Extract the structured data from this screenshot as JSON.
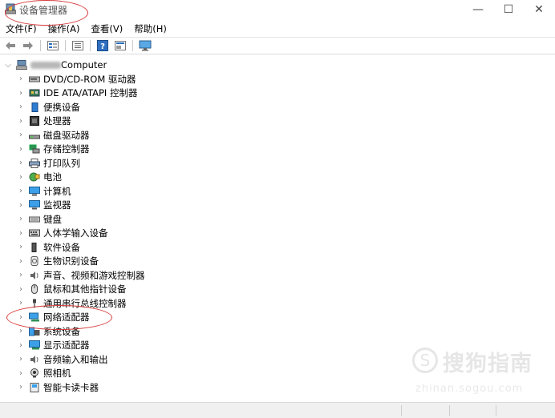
{
  "window": {
    "title": "设备管理器",
    "controls": {
      "minimize": "—",
      "maximize": "☐",
      "close": "✕"
    }
  },
  "menu": [
    {
      "label": "文件(F)"
    },
    {
      "label": "操作(A)"
    },
    {
      "label": "查看(V)"
    },
    {
      "label": "帮助(H)"
    }
  ],
  "toolbar": {
    "buttons": [
      "back-arrow-icon",
      "forward-arrow-icon",
      "properties-icon",
      "list-view-icon",
      "help-icon",
      "scan-hardware-icon",
      "monitor-icon"
    ]
  },
  "tree": {
    "root": {
      "label": "Computer",
      "expanded": true
    },
    "items": [
      {
        "label": "DVD/CD-ROM 驱动器",
        "icon": "dvd-drive-icon"
      },
      {
        "label": "IDE ATA/ATAPI 控制器",
        "icon": "ide-controller-icon"
      },
      {
        "label": "便携设备",
        "icon": "portable-device-icon"
      },
      {
        "label": "处理器",
        "icon": "processor-icon"
      },
      {
        "label": "磁盘驱动器",
        "icon": "disk-drive-icon"
      },
      {
        "label": "存储控制器",
        "icon": "storage-controller-icon"
      },
      {
        "label": "打印队列",
        "icon": "printer-icon"
      },
      {
        "label": "电池",
        "icon": "battery-icon"
      },
      {
        "label": "计算机",
        "icon": "computer-icon"
      },
      {
        "label": "监视器",
        "icon": "monitor-icon"
      },
      {
        "label": "键盘",
        "icon": "keyboard-icon"
      },
      {
        "label": "人体学输入设备",
        "icon": "hid-icon"
      },
      {
        "label": "软件设备",
        "icon": "software-device-icon"
      },
      {
        "label": "生物识别设备",
        "icon": "biometric-icon"
      },
      {
        "label": "声音、视频和游戏控制器",
        "icon": "speaker-icon"
      },
      {
        "label": "鼠标和其他指针设备",
        "icon": "mouse-icon"
      },
      {
        "label": "通用串行总线控制器",
        "icon": "usb-icon"
      },
      {
        "label": "网络适配器",
        "icon": "network-adapter-icon"
      },
      {
        "label": "系统设备",
        "icon": "system-device-icon"
      },
      {
        "label": "显示适配器",
        "icon": "display-adapter-icon"
      },
      {
        "label": "音频输入和输出",
        "icon": "audio-io-icon"
      },
      {
        "label": "照相机",
        "icon": "camera-icon"
      },
      {
        "label": "智能卡读卡器",
        "icon": "smartcard-reader-icon"
      }
    ]
  },
  "watermark": {
    "text": "搜狗指南",
    "url": "zhinan.sogou.com"
  },
  "colors": {
    "accent_blue": "#1e73c8",
    "annotation_red": "#d63a3a"
  }
}
